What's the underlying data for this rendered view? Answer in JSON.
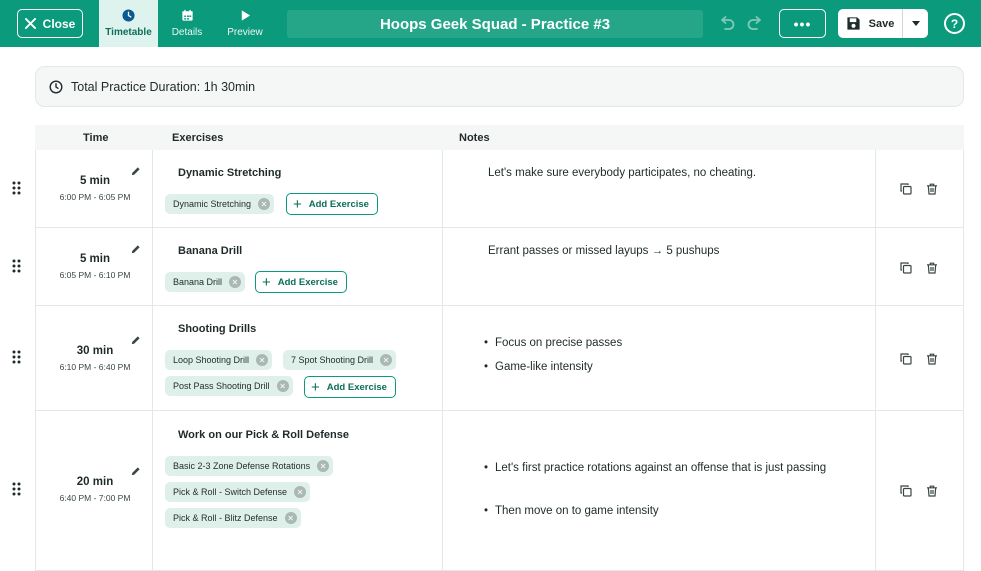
{
  "topbar": {
    "close_label": "Close",
    "tabs": [
      {
        "label": "Timetable",
        "icon": "clock-icon",
        "active": true
      },
      {
        "label": "Details",
        "icon": "calendar-icon",
        "active": false
      },
      {
        "label": "Preview",
        "icon": "play-icon",
        "active": false
      }
    ],
    "title": "Hoops Geek Squad - Practice #3",
    "more_label": "•••",
    "save_label": "Save",
    "help_label": "?"
  },
  "summary": {
    "duration_label": "Total Practice Duration: 1h 30min"
  },
  "table": {
    "headers": {
      "time": "Time",
      "exercises": "Exercises",
      "notes": "Notes"
    },
    "add_exercise_label": "Add Exercise",
    "rows": [
      {
        "minutes": "5 min",
        "range": "6:00 PM - 6:05 PM",
        "title": "Dynamic Stretching",
        "chips": [
          "Dynamic Stretching"
        ],
        "note": "Let's make sure everybody participates, no cheating."
      },
      {
        "minutes": "5 min",
        "range": "6:05 PM - 6:10 PM",
        "title": "Banana Drill",
        "chips": [
          "Banana Drill"
        ],
        "note": "Errant passes or missed layups → 5 pushups"
      },
      {
        "minutes": "30 min",
        "range": "6:10 PM - 6:40 PM",
        "title": "Shooting Drills",
        "chips": [
          "Loop Shooting Drill",
          "7 Spot Shooting Drill",
          "Post Pass Shooting Drill"
        ],
        "bullets": [
          "Focus on precise passes",
          "Game-like intensity"
        ]
      },
      {
        "minutes": "20 min",
        "range": "6:40 PM - 7:00 PM",
        "title": "Work on our Pick & Roll Defense",
        "chips": [
          "Basic 2-3 Zone Defense Rotations",
          "Pick & Roll - Switch Defense",
          "Pick & Roll - Blitz Defense"
        ],
        "bullets": [
          "Let's first practice rotations against an offense that is just passing",
          "Then move on to game intensity"
        ]
      }
    ]
  },
  "colors": {
    "brand": "#0c9a7c",
    "chip_bg": "#dff0ea",
    "header_bg": "#f5f7f6"
  }
}
